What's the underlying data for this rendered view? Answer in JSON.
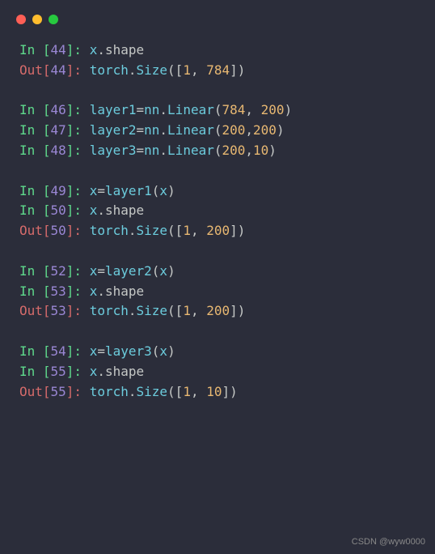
{
  "window": {
    "controls": [
      "red",
      "yellow",
      "green"
    ]
  },
  "colors": {
    "bg": "#2b2d3a",
    "in_label": "#5fd98c",
    "out_label": "#d66b6b",
    "bracket_num": "#9a87d4",
    "identifier": "#6cccdd",
    "number": "#e8b872",
    "default": "#c5c8c6"
  },
  "cells": [
    {
      "kind": "in",
      "n": "44",
      "tokens": [
        {
          "t": "var",
          "v": "x"
        },
        {
          "t": "dot",
          "v": "."
        },
        {
          "t": "attr",
          "v": "shape"
        }
      ]
    },
    {
      "kind": "out",
      "n": "44",
      "tokens": [
        {
          "t": "var",
          "v": "torch"
        },
        {
          "t": "dot",
          "v": "."
        },
        {
          "t": "func",
          "v": "Size"
        },
        {
          "t": "paren",
          "v": "(["
        },
        {
          "t": "num",
          "v": "1"
        },
        {
          "t": "comma",
          "v": ", "
        },
        {
          "t": "num",
          "v": "784"
        },
        {
          "t": "paren",
          "v": "])"
        }
      ]
    },
    {
      "kind": "blank"
    },
    {
      "kind": "in",
      "n": "46",
      "tokens": [
        {
          "t": "var",
          "v": "layer1"
        },
        {
          "t": "eq",
          "v": "="
        },
        {
          "t": "var",
          "v": "nn"
        },
        {
          "t": "dot",
          "v": "."
        },
        {
          "t": "func",
          "v": "Linear"
        },
        {
          "t": "paren",
          "v": "("
        },
        {
          "t": "num",
          "v": "784"
        },
        {
          "t": "comma",
          "v": ", "
        },
        {
          "t": "num",
          "v": "200"
        },
        {
          "t": "paren",
          "v": ")"
        }
      ]
    },
    {
      "kind": "in",
      "n": "47",
      "tokens": [
        {
          "t": "var",
          "v": "layer2"
        },
        {
          "t": "eq",
          "v": "="
        },
        {
          "t": "var",
          "v": "nn"
        },
        {
          "t": "dot",
          "v": "."
        },
        {
          "t": "func",
          "v": "Linear"
        },
        {
          "t": "paren",
          "v": "("
        },
        {
          "t": "num",
          "v": "200"
        },
        {
          "t": "comma",
          "v": ","
        },
        {
          "t": "num",
          "v": "200"
        },
        {
          "t": "paren",
          "v": ")"
        }
      ]
    },
    {
      "kind": "in",
      "n": "48",
      "tokens": [
        {
          "t": "var",
          "v": "layer3"
        },
        {
          "t": "eq",
          "v": "="
        },
        {
          "t": "var",
          "v": "nn"
        },
        {
          "t": "dot",
          "v": "."
        },
        {
          "t": "func",
          "v": "Linear"
        },
        {
          "t": "paren",
          "v": "("
        },
        {
          "t": "num",
          "v": "200"
        },
        {
          "t": "comma",
          "v": ","
        },
        {
          "t": "num",
          "v": "10"
        },
        {
          "t": "paren",
          "v": ")"
        }
      ]
    },
    {
      "kind": "blank"
    },
    {
      "kind": "in",
      "n": "49",
      "tokens": [
        {
          "t": "var",
          "v": "x"
        },
        {
          "t": "eq",
          "v": "="
        },
        {
          "t": "var",
          "v": "layer1"
        },
        {
          "t": "paren",
          "v": "("
        },
        {
          "t": "var",
          "v": "x"
        },
        {
          "t": "paren",
          "v": ")"
        }
      ]
    },
    {
      "kind": "in",
      "n": "50",
      "tokens": [
        {
          "t": "var",
          "v": "x"
        },
        {
          "t": "dot",
          "v": "."
        },
        {
          "t": "attr",
          "v": "shape"
        }
      ]
    },
    {
      "kind": "out",
      "n": "50",
      "tokens": [
        {
          "t": "var",
          "v": "torch"
        },
        {
          "t": "dot",
          "v": "."
        },
        {
          "t": "func",
          "v": "Size"
        },
        {
          "t": "paren",
          "v": "(["
        },
        {
          "t": "num",
          "v": "1"
        },
        {
          "t": "comma",
          "v": ", "
        },
        {
          "t": "num",
          "v": "200"
        },
        {
          "t": "paren",
          "v": "])"
        }
      ]
    },
    {
      "kind": "blank"
    },
    {
      "kind": "in",
      "n": "52",
      "tokens": [
        {
          "t": "var",
          "v": "x"
        },
        {
          "t": "eq",
          "v": "="
        },
        {
          "t": "var",
          "v": "layer2"
        },
        {
          "t": "paren",
          "v": "("
        },
        {
          "t": "var",
          "v": "x"
        },
        {
          "t": "paren",
          "v": ")"
        }
      ]
    },
    {
      "kind": "in",
      "n": "53",
      "tokens": [
        {
          "t": "var",
          "v": "x"
        },
        {
          "t": "dot",
          "v": "."
        },
        {
          "t": "attr",
          "v": "shape"
        }
      ]
    },
    {
      "kind": "out",
      "n": "53",
      "tokens": [
        {
          "t": "var",
          "v": "torch"
        },
        {
          "t": "dot",
          "v": "."
        },
        {
          "t": "func",
          "v": "Size"
        },
        {
          "t": "paren",
          "v": "(["
        },
        {
          "t": "num",
          "v": "1"
        },
        {
          "t": "comma",
          "v": ", "
        },
        {
          "t": "num",
          "v": "200"
        },
        {
          "t": "paren",
          "v": "])"
        }
      ]
    },
    {
      "kind": "blank"
    },
    {
      "kind": "in",
      "n": "54",
      "tokens": [
        {
          "t": "var",
          "v": "x"
        },
        {
          "t": "eq",
          "v": "="
        },
        {
          "t": "var",
          "v": "layer3"
        },
        {
          "t": "paren",
          "v": "("
        },
        {
          "t": "var",
          "v": "x"
        },
        {
          "t": "paren",
          "v": ")"
        }
      ]
    },
    {
      "kind": "in",
      "n": "55",
      "tokens": [
        {
          "t": "var",
          "v": "x"
        },
        {
          "t": "dot",
          "v": "."
        },
        {
          "t": "attr",
          "v": "shape"
        }
      ]
    },
    {
      "kind": "out",
      "n": "55",
      "tokens": [
        {
          "t": "var",
          "v": "torch"
        },
        {
          "t": "dot",
          "v": "."
        },
        {
          "t": "func",
          "v": "Size"
        },
        {
          "t": "paren",
          "v": "(["
        },
        {
          "t": "num",
          "v": "1"
        },
        {
          "t": "comma",
          "v": ", "
        },
        {
          "t": "num",
          "v": "10"
        },
        {
          "t": "paren",
          "v": "])"
        }
      ]
    }
  ],
  "prompts": {
    "in_prefix": "In [",
    "in_suffix": "]: ",
    "out_prefix": "Out[",
    "out_suffix": "]: "
  },
  "watermark": "CSDN @wyw0000"
}
